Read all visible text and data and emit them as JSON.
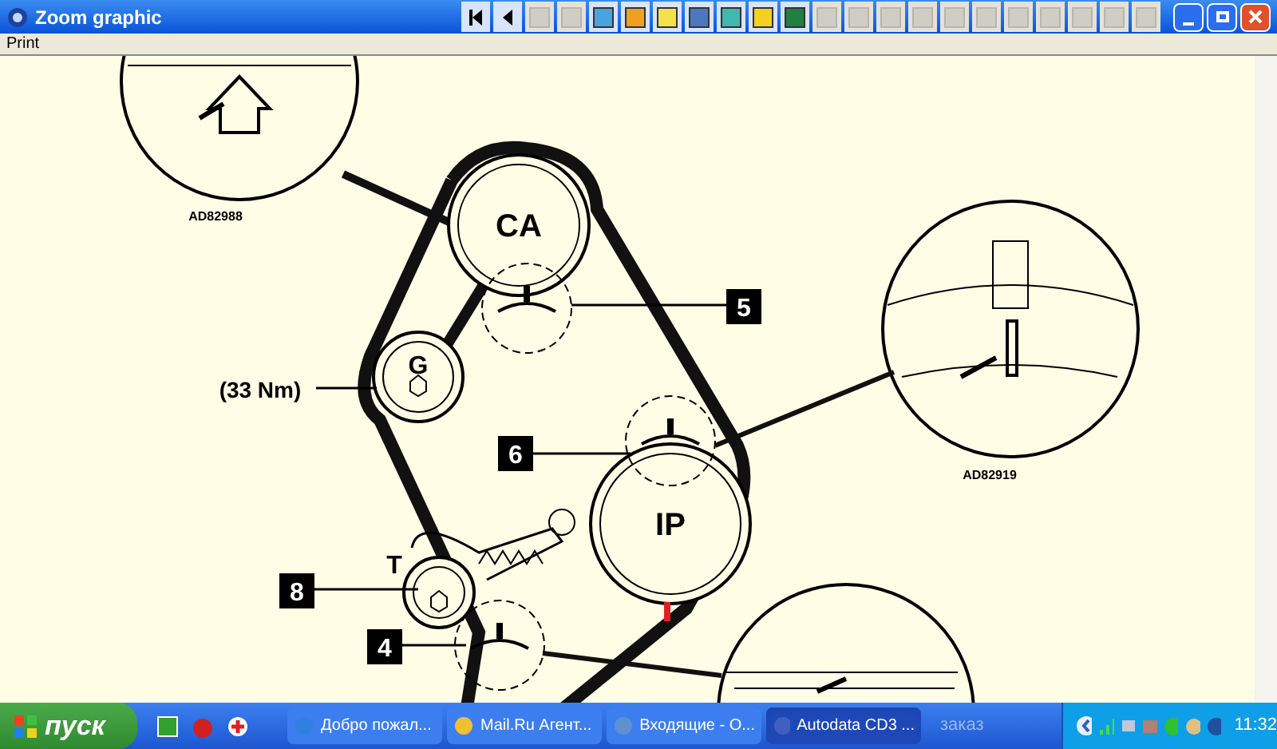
{
  "window": {
    "title": "Zoom graphic"
  },
  "toolbar": [
    {
      "kind": "first",
      "disabled": false
    },
    {
      "kind": "prev",
      "disabled": false
    },
    {
      "kind": "tool",
      "disabled": true
    },
    {
      "kind": "tool",
      "disabled": true
    },
    {
      "kind": "tool",
      "disabled": false,
      "color": "#4aa3df"
    },
    {
      "kind": "tool",
      "disabled": false,
      "color": "#f0a020"
    },
    {
      "kind": "tool",
      "disabled": false,
      "color": "#f4e04a"
    },
    {
      "kind": "tool",
      "disabled": false,
      "color": "#4a78c0"
    },
    {
      "kind": "tool",
      "disabled": false,
      "color": "#40b8b0"
    },
    {
      "kind": "tool",
      "disabled": false,
      "color": "#f4d020"
    },
    {
      "kind": "tool",
      "disabled": false,
      "color": "#208040"
    },
    {
      "kind": "tool",
      "disabled": true
    },
    {
      "kind": "tool",
      "disabled": true
    },
    {
      "kind": "tool",
      "disabled": true
    },
    {
      "kind": "tool",
      "disabled": true
    },
    {
      "kind": "tool",
      "disabled": true
    },
    {
      "kind": "tool",
      "disabled": true
    },
    {
      "kind": "tool",
      "disabled": true
    },
    {
      "kind": "tool",
      "disabled": true
    },
    {
      "kind": "tool",
      "disabled": true
    },
    {
      "kind": "tool",
      "disabled": true
    },
    {
      "kind": "tool",
      "disabled": true
    }
  ],
  "menu": [
    "Print"
  ],
  "diagram": {
    "pulleys": [
      "CA",
      "G",
      "IP",
      "T"
    ],
    "torque": "(33 Nm)",
    "callouts": [
      "5",
      "6",
      "8",
      "4"
    ],
    "references": [
      "AD82988",
      "AD82919"
    ]
  },
  "taskbar": {
    "start": "пуск",
    "tasks": [
      {
        "label": "Добро пожал...",
        "selected": false
      },
      {
        "label": "Mail.Ru Агент...",
        "selected": false
      },
      {
        "label": "Входящие - О...",
        "selected": false
      },
      {
        "label": "Autodata CD3 ...",
        "selected": true
      }
    ],
    "toolbar_label": "заказ",
    "clock": "11:32"
  }
}
